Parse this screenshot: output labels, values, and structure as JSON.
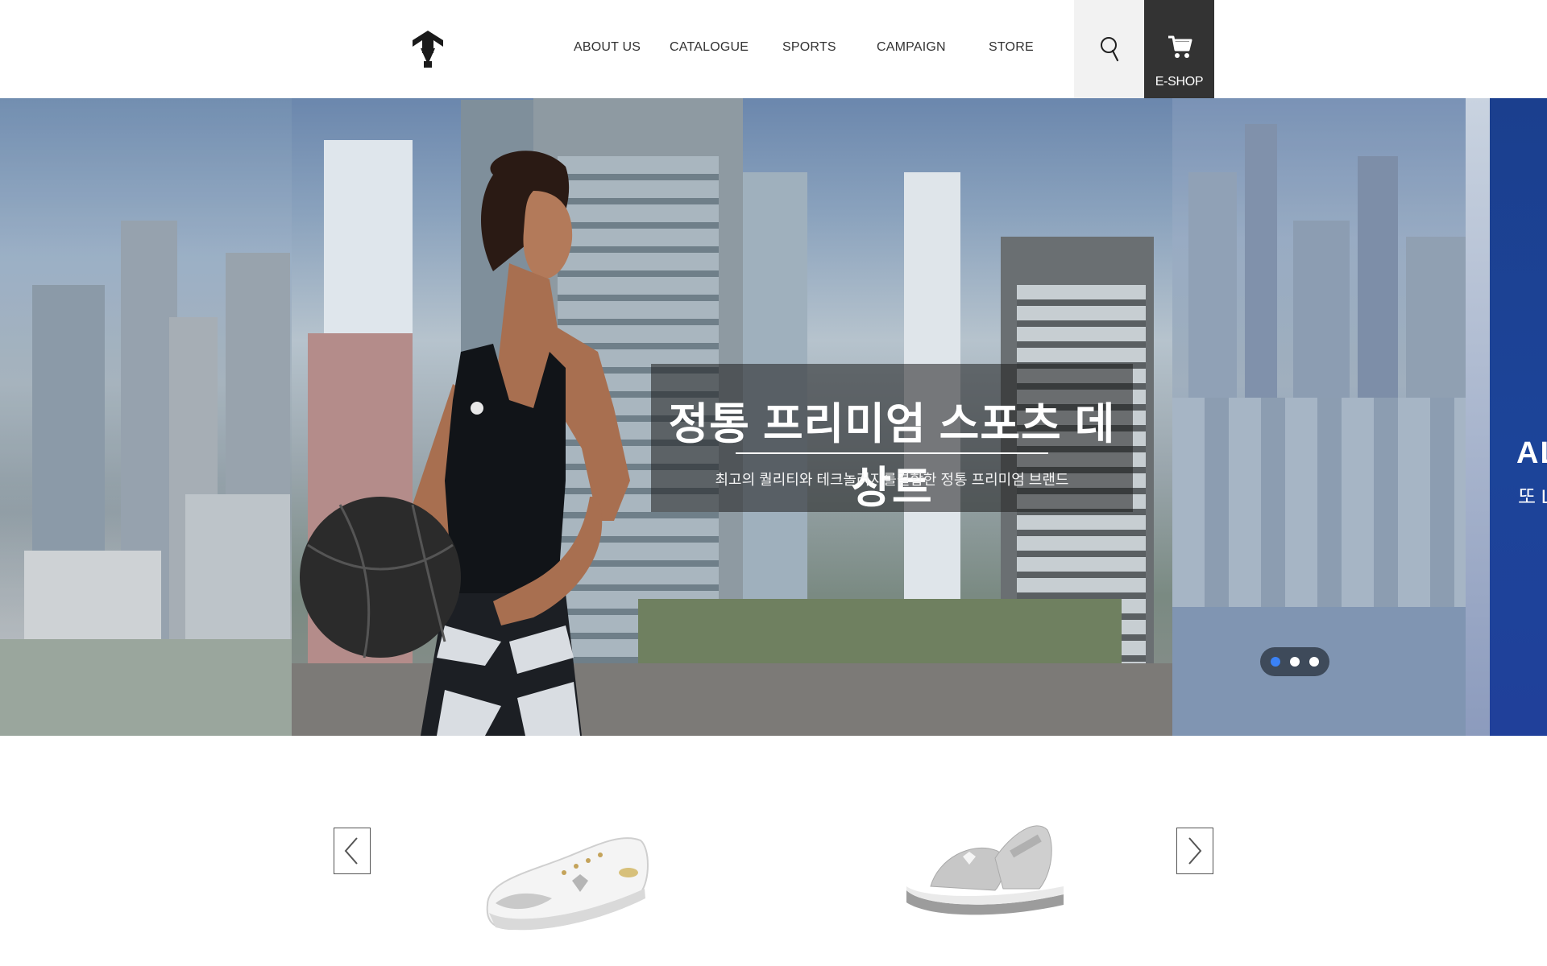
{
  "header": {
    "logo_alt": "Descente",
    "nav": [
      {
        "label": "ABOUT US"
      },
      {
        "label": "CATALOGUE"
      },
      {
        "label": "SPORTS"
      },
      {
        "label": "CAMPAIGN"
      },
      {
        "label": "STORE"
      }
    ],
    "search_icon": "search-icon",
    "eshop_label": "E-SHOP",
    "eshop_icon": "cart-icon"
  },
  "hero": {
    "caption_title": "정통 프리미엄 스포츠 데상트",
    "caption_subtitle": "최고의 퀄리티와 테크놀러지를결합한 정통 프리미엄 브랜드",
    "next_slide_title": "AL",
    "next_slide_subtitle": "또 L",
    "slides_count": 3,
    "active_slide": 1
  },
  "products": {
    "items": [
      {
        "name": "white-sneaker"
      },
      {
        "name": "gray-sandal"
      }
    ],
    "prev_icon": "chevron-left-icon",
    "next_icon": "chevron-right-icon"
  },
  "colors": {
    "eshop_bg": "#333333",
    "search_bg": "#f2f2f2",
    "dot_active": "#3b82f6"
  }
}
